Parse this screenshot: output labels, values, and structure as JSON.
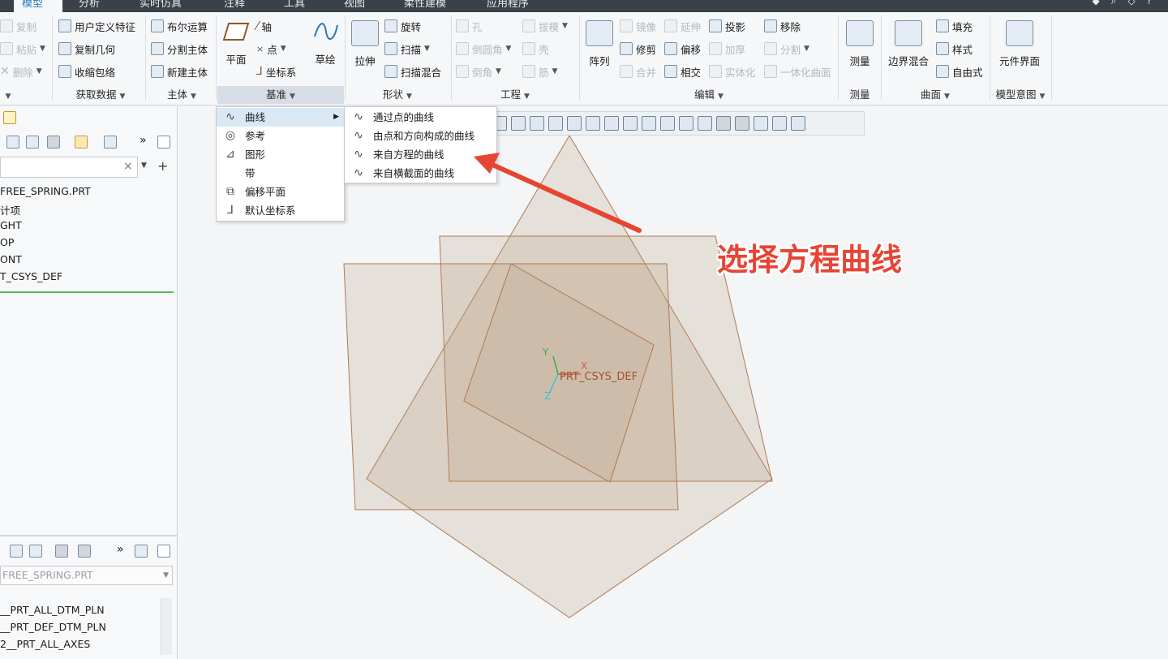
{
  "tabs": [
    {
      "label": "模型",
      "active": true
    },
    {
      "label": "分析"
    },
    {
      "label": "实时仿真"
    },
    {
      "label": "注释"
    },
    {
      "label": "工具"
    },
    {
      "label": "视图"
    },
    {
      "label": "柔性建模"
    },
    {
      "label": "应用程序"
    }
  ],
  "ribbon": {
    "operations": {
      "copy": "复制",
      "paste": "粘贴",
      "delete": "删除"
    },
    "get_data": {
      "udf": "用户定义特征",
      "copy_geom": "复制几何",
      "shrinkwrap": "收缩包络",
      "group": "获取数据"
    },
    "body": {
      "boolean": "布尔运算",
      "split": "分割主体",
      "new_body": "新建主体",
      "group": "主体"
    },
    "datum": {
      "plane": "平面",
      "axis": "轴",
      "point": "点",
      "csys": "坐标系",
      "sketch": "草绘",
      "group": "基准"
    },
    "shapes": {
      "extrude": "拉伸",
      "revolve": "旋转",
      "sweep": "扫描",
      "swept_blend": "扫描混合",
      "group": "形状"
    },
    "engineering": {
      "hole": "孔",
      "round": "倒圆角",
      "chamfer": "倒角",
      "draft": "拔模",
      "shell": "壳",
      "rib": "筋",
      "group": "工程"
    },
    "editing": {
      "pattern": "阵列",
      "mirror": "镜像",
      "trim": "修剪",
      "merge": "合并",
      "extend": "延伸",
      "offset": "偏移",
      "intersect": "相交",
      "project": "投影",
      "thicken": "加厚",
      "solidify": "实体化",
      "remove": "移除",
      "split": "分割",
      "unify": "一体化曲面",
      "group": "编辑"
    },
    "measure": {
      "measure": "测量",
      "group": "测量"
    },
    "surfaces": {
      "boundary_blend": "边界混合",
      "fill": "填充",
      "style": "样式",
      "freestyle": "自由式",
      "group": "曲面"
    },
    "model_intent": {
      "component_interface": "元件界面",
      "group": "模型意图"
    }
  },
  "model_tree": {
    "search_placeholder": "",
    "items": [
      "FREE_SPRING.PRT",
      "计项",
      "GHT",
      "OP",
      "ONT",
      "T_CSYS_DEF"
    ]
  },
  "layer_tree": {
    "selector": "FREE_SPRING.PRT",
    "items": [
      "__PRT_ALL_DTM_PLN",
      "__PRT_DEF_DTM_PLN",
      "2__PRT_ALL_AXES"
    ]
  },
  "datum_menu": {
    "items": [
      {
        "label": "曲线",
        "icon": "curve-icon",
        "submenu": true,
        "highlighted": true
      },
      {
        "label": "参考",
        "icon": "reference-icon"
      },
      {
        "label": "图形",
        "icon": "graph-icon"
      },
      {
        "label": "带",
        "icon": ""
      },
      {
        "label": "偏移平面",
        "icon": "offset-plane-icon"
      },
      {
        "label": "默认坐标系",
        "icon": "default-csys-icon"
      }
    ]
  },
  "curve_submenu": {
    "items": [
      "通过点的曲线",
      "由点和方向构成的曲线",
      "来自方程的曲线",
      "来自横截面的曲线"
    ]
  },
  "viewport": {
    "csys_label": "PRT_CSYS_DEF",
    "axis_x": "X",
    "axis_y": "Y",
    "axis_z": "Z"
  },
  "annotation": {
    "text": "选择方程曲线",
    "color": "#e64534"
  }
}
